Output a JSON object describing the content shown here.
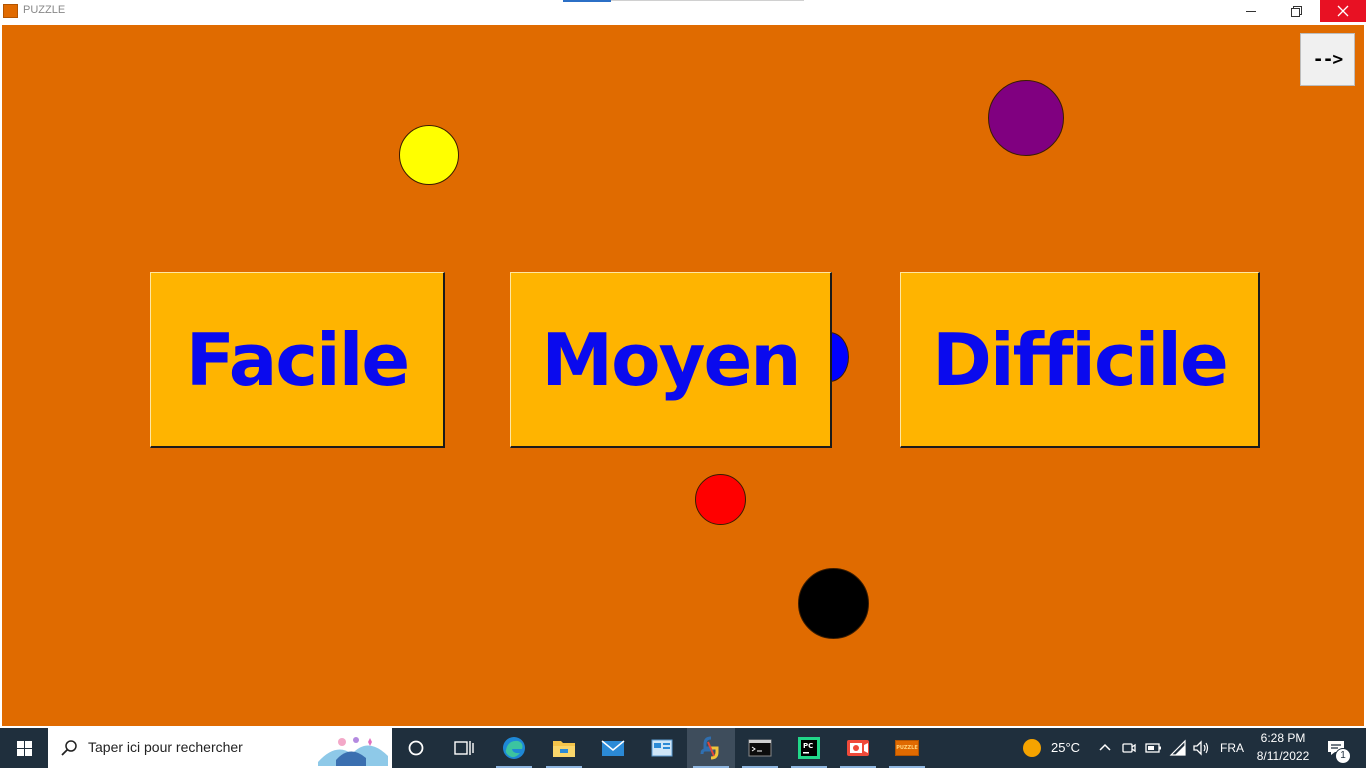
{
  "window": {
    "title": "PUZZLE",
    "app_icon_label": "PUZZLE",
    "minimize_glyph": "—",
    "restore_glyph": "❐",
    "close_glyph": "✕"
  },
  "game": {
    "background_color": "#e06b00",
    "buttons": {
      "easy": "Facile",
      "medium": "Moyen",
      "hard": "Difficile",
      "next": "-->"
    },
    "balls": [
      {
        "name": "yellow-ball",
        "color": "#ffff00"
      },
      {
        "name": "purple-ball",
        "color": "#800080"
      },
      {
        "name": "blue-ball",
        "color": "#0000ff"
      },
      {
        "name": "red-ball",
        "color": "#ff0000"
      },
      {
        "name": "black-ball",
        "color": "#000000"
      }
    ]
  },
  "taskbar": {
    "search_placeholder": "Taper ici pour rechercher",
    "weather": "25°C",
    "language": "FRA",
    "time": "6:28 PM",
    "date": "8/11/2022",
    "notification_count": "1",
    "pinned_apps": [
      "cortana-icon",
      "task-view-icon",
      "edge-icon",
      "file-explorer-icon",
      "mail-icon",
      "control-panel-icon",
      "python-idle-icon",
      "terminal-icon",
      "pycharm-icon",
      "screen-recorder-icon",
      "puzzle-app-icon"
    ],
    "puzzle_label": "PUZZLE"
  }
}
